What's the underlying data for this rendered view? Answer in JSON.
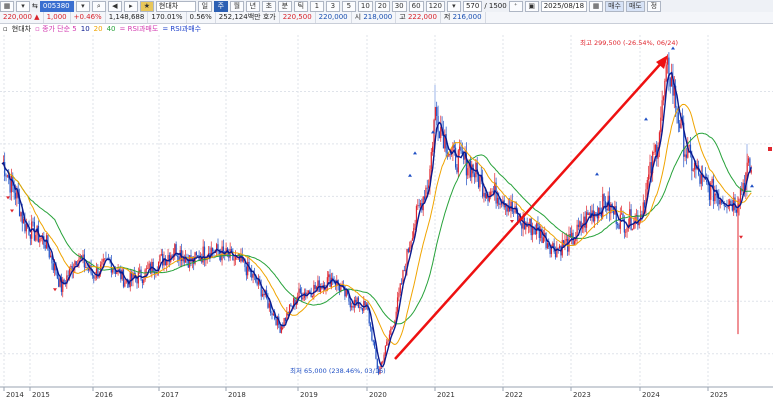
{
  "toolbar": {
    "code": "005380",
    "name": "현대차",
    "period_tabs": [
      "일",
      "주",
      "월",
      "년",
      "초",
      "분",
      "틱"
    ],
    "active_tab": "주",
    "intervals": [
      "1",
      "3",
      "5",
      "10",
      "20",
      "30",
      "60",
      "120"
    ],
    "count": "570",
    "count_max": "/ 1500",
    "date": "2025/08/18",
    "buy_label": "매수",
    "sell_label": "매도",
    "extra_label": "정"
  },
  "quote": {
    "price": "220,000",
    "change": "1,000",
    "change_pct": "+0.46%",
    "volume": "1,148,688",
    "volume_pct": "170.01%",
    "turnover_rate": "0.56%",
    "trade_value": "252,124백만",
    "hoga_label": "호가",
    "ask": "220,500",
    "bid": "220,000",
    "open_label": "시",
    "open": "218,000",
    "high_label": "고",
    "high": "222,000",
    "low_label": "저",
    "low": "216,000"
  },
  "legend": {
    "name": "현대차",
    "ma": "종가 단순 5",
    "ma10": "10",
    "ma20": "20",
    "ma40": "40",
    "rsi_over": "RSI과매도",
    "rsi_over_sep": "=",
    "rsi_buy": "RSI과매수"
  },
  "annotations": {
    "high": "최고 299,500 (-26.54%, 06/24)",
    "low": "최저 65,000 (238.46%, 03/16)"
  },
  "colors": {
    "up": "#e0262e",
    "down": "#1f4fc4",
    "ma5": "#0a1a8f",
    "ma20": "#f0a400",
    "ma40": "#27a23a",
    "arrow": "#ee1111"
  },
  "chart_data": {
    "type": "candlestick",
    "x_axis": [
      "2014",
      "2015",
      "2016",
      "2017",
      "2018",
      "2019",
      "2020",
      "2021",
      "2022",
      "2023",
      "2024",
      "2025"
    ],
    "y_range": [
      60000,
      320000
    ],
    "grid": true,
    "close_series": [
      [
        "2014-01",
        225000
      ],
      [
        "2014-04",
        210000
      ],
      [
        "2014-07",
        200000
      ],
      [
        "2014-10",
        180000
      ],
      [
        "2015-01",
        175000
      ],
      [
        "2015-04",
        165000
      ],
      [
        "2015-07",
        130000
      ],
      [
        "2015-10",
        155000
      ],
      [
        "2016-01",
        140000
      ],
      [
        "2016-04",
        150000
      ],
      [
        "2016-07",
        135000
      ],
      [
        "2016-10",
        140000
      ],
      [
        "2017-01",
        150000
      ],
      [
        "2017-04",
        160000
      ],
      [
        "2017-07",
        150000
      ],
      [
        "2017-10",
        160000
      ],
      [
        "2018-01",
        155000
      ],
      [
        "2018-04",
        148000
      ],
      [
        "2018-07",
        128000
      ],
      [
        "2018-10",
        100000
      ],
      [
        "2019-01",
        125000
      ],
      [
        "2019-04",
        130000
      ],
      [
        "2019-07",
        138000
      ],
      [
        "2019-10",
        120000
      ],
      [
        "2020-01",
        115000
      ],
      [
        "2020-03",
        65000
      ],
      [
        "2020-06",
        110000
      ],
      [
        "2020-09",
        175000
      ],
      [
        "2020-12",
        215000
      ],
      [
        "2021-01",
        265000
      ],
      [
        "2021-04",
        230000
      ],
      [
        "2021-07",
        225000
      ],
      [
        "2021-10",
        205000
      ],
      [
        "2022-01",
        200000
      ],
      [
        "2022-04",
        180000
      ],
      [
        "2022-07",
        175000
      ],
      [
        "2022-10",
        160000
      ],
      [
        "2023-01",
        165000
      ],
      [
        "2023-04",
        185000
      ],
      [
        "2023-07",
        195000
      ],
      [
        "2023-10",
        180000
      ],
      [
        "2024-01",
        185000
      ],
      [
        "2024-04",
        240000
      ],
      [
        "2024-06",
        299500
      ],
      [
        "2024-09",
        235000
      ],
      [
        "2024-12",
        210000
      ],
      [
        "2025-03",
        200000
      ],
      [
        "2025-06",
        195000
      ],
      [
        "2025-08",
        220000
      ]
    ],
    "high_point": {
      "date": "2024-06",
      "value": 299500
    },
    "low_point": {
      "date": "2020-03",
      "value": 65000
    }
  }
}
